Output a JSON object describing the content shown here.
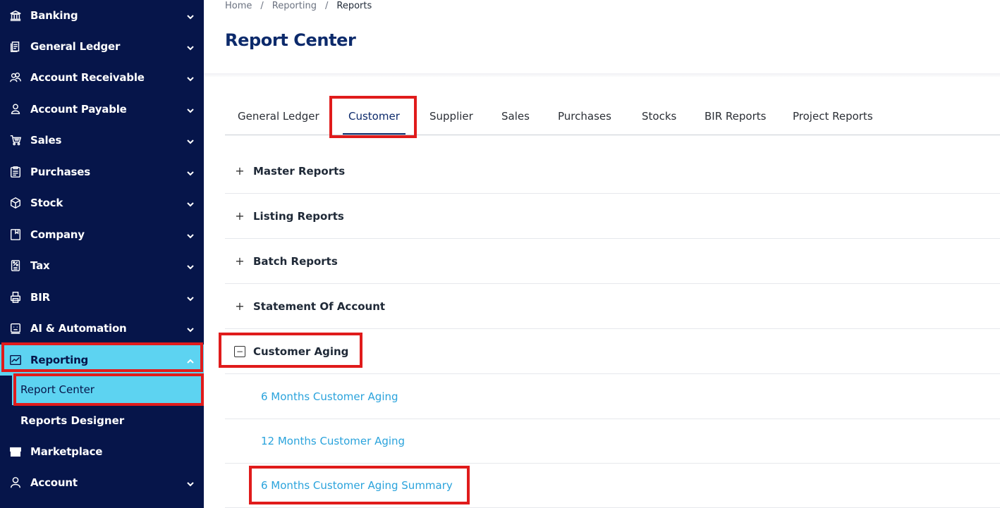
{
  "sidebar": {
    "items": [
      {
        "label": "Banking",
        "icon": "bank-icon"
      },
      {
        "label": "General Ledger",
        "icon": "ledger-icon"
      },
      {
        "label": "Account Receivable",
        "icon": "users-icon"
      },
      {
        "label": "Account Payable",
        "icon": "user-icon"
      },
      {
        "label": "Sales",
        "icon": "cart-icon"
      },
      {
        "label": "Purchases",
        "icon": "clipboard-icon"
      },
      {
        "label": "Stock",
        "icon": "cube-icon"
      },
      {
        "label": "Company",
        "icon": "bookmark-icon"
      },
      {
        "label": "Tax",
        "icon": "percent-icon"
      },
      {
        "label": "BIR",
        "icon": "printer-icon"
      },
      {
        "label": "AI & Automation",
        "icon": "robot-icon"
      },
      {
        "label": "Reporting",
        "icon": "chart-line-icon"
      },
      {
        "label": "Marketplace",
        "icon": "store-icon"
      },
      {
        "label": "Account",
        "icon": "person-icon"
      }
    ],
    "reporting_sub": [
      {
        "label": "Report Center"
      },
      {
        "label": "Reports Designer"
      }
    ]
  },
  "breadcrumb": {
    "home": "Home",
    "sep1": "/",
    "middle": "Reporting",
    "sep2": "/",
    "current": "Reports"
  },
  "page_title": "Report Center",
  "tabs": [
    {
      "label": "General Ledger"
    },
    {
      "label": "Customer"
    },
    {
      "label": "Supplier"
    },
    {
      "label": "Sales"
    },
    {
      "label": "Purchases"
    },
    {
      "label": "Stocks"
    },
    {
      "label": "BIR Reports"
    },
    {
      "label": "Project Reports"
    }
  ],
  "sections": [
    {
      "label": "Master Reports",
      "toggle": "+"
    },
    {
      "label": "Listing Reports",
      "toggle": "+"
    },
    {
      "label": "Batch Reports",
      "toggle": "+"
    },
    {
      "label": "Statement Of Account",
      "toggle": "+"
    },
    {
      "label": "Customer Aging",
      "toggle": "−"
    }
  ],
  "aging_links": [
    {
      "label": "6 Months Customer Aging"
    },
    {
      "label": "12 Months Customer Aging"
    },
    {
      "label": "6 Months Customer Aging Summary"
    }
  ],
  "colors": {
    "sidebar_bg": "#06154a",
    "active_bg": "#5dd3f1",
    "title": "#0c2a6b",
    "link": "#2aa3dc",
    "highlight": "#e01b1b"
  }
}
